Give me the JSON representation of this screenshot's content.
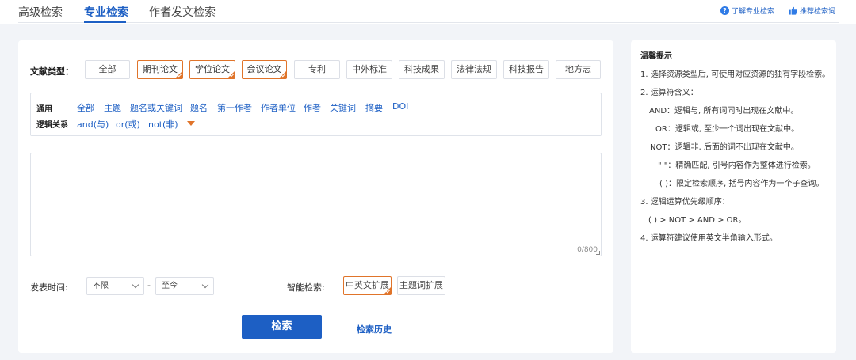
{
  "tabs": [
    {
      "label": "高级检索",
      "active": false
    },
    {
      "label": "专业检索",
      "active": true
    },
    {
      "label": "作者发文检索",
      "active": false
    }
  ],
  "help": {
    "learn_label": "了解专业检索",
    "recommend_label": "推荐检索词"
  },
  "doc_type": {
    "label": "文献类型：",
    "options": [
      {
        "label": "全部",
        "selected": false
      },
      {
        "label": "期刊论文",
        "selected": true
      },
      {
        "label": "学位论文",
        "selected": true
      },
      {
        "label": "会议论文",
        "selected": true
      },
      {
        "label": "专利",
        "selected": false
      },
      {
        "label": "中外标准",
        "selected": false
      },
      {
        "label": "科技成果",
        "selected": false
      },
      {
        "label": "法律法规",
        "selected": false
      },
      {
        "label": "科技报告",
        "selected": false
      },
      {
        "label": "地方志",
        "selected": false
      }
    ]
  },
  "fields": {
    "general_label": "通用",
    "general_items": [
      "全部",
      "主题",
      "题名或关键词",
      "题名",
      "第一作者",
      "作者单位",
      "作者",
      "关键词",
      "摘要",
      "DOI"
    ],
    "logic_label": "逻辑关系",
    "logic_items": [
      "and(与)",
      "or(或)",
      "not(非)"
    ]
  },
  "query": {
    "value": "",
    "char_count": "0/800"
  },
  "publish_time": {
    "label": "发表时间:",
    "from_value": "不限",
    "to_value": "至今",
    "separator": "-"
  },
  "smart_search": {
    "label": "智能检索:",
    "options": [
      {
        "label": "中英文扩展",
        "selected": true
      },
      {
        "label": "主题词扩展",
        "selected": false
      }
    ]
  },
  "actions": {
    "search_label": "检索",
    "history_label": "检索历史"
  },
  "tips": {
    "title": "温馨提示",
    "lines": [
      "1. 选择资源类型后, 可使用对应资源的独有字段检索。",
      "2. 运算符含义：",
      "AND：逻辑与, 所有词同时出现在文献中。",
      "OR：逻辑或, 至少一个词出现在文献中。",
      "NOT：逻辑非, 后面的词不出现在文献中。",
      "\" \"：精确匹配, 引号内容作为整体进行检索。",
      "( )：限定检索顺序, 括号内容作为一个子查询。",
      "3. 逻辑运算优先级顺序：",
      "( ) > NOT > AND > OR。",
      "4. 运算符建议使用英文半角输入形式。"
    ]
  },
  "colors": {
    "accent": "#1d5fc4",
    "selected_border": "#e0742a",
    "background": "#f2f4f8"
  }
}
